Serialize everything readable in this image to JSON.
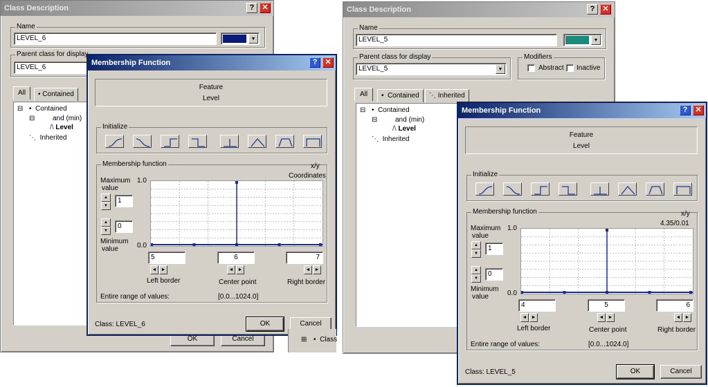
{
  "left": {
    "class_desc": {
      "title": "Class Description",
      "name_label": "Name",
      "name_value": "LEVEL_6",
      "color": "#0a1a7a",
      "parent_label": "Parent class for display",
      "parent_value": "LEVEL_6",
      "tabs": [
        "All",
        "Contained"
      ],
      "tree": {
        "contained": "Contained",
        "and": "and (min)",
        "level": "Level",
        "inherited": "Inherited"
      },
      "ok_label": "OK",
      "cancel_label": "Cancel"
    },
    "mf": {
      "title": "Membership Function",
      "feature_label": "Feature",
      "feature_value": "Level",
      "initialize_label": "Initialize",
      "mf_label": "Membership function",
      "xy_label": "x/y",
      "coord_text": "Coordinates",
      "max_label_1": "Maximum",
      "max_label_2": "value",
      "max_value": "1",
      "min_label_1": "Minimum",
      "min_label_2": "value",
      "min_value": "0",
      "y_top": "1.0",
      "y_bottom": "0.0",
      "left_border_value": "5",
      "center_value": "6",
      "right_border_value": "7",
      "left_border_label": "Left border",
      "center_label": "Center point",
      "right_border_label": "Right border",
      "range_label": "Entire range of values:",
      "range_value": "[0.0...1024.0]",
      "class_text": "Class: LEVEL_6",
      "ok_label": "OK",
      "cancel_label": "Cancel",
      "membership": {
        "x": [
          5,
          6,
          7
        ],
        "y": [
          0,
          1,
          0
        ]
      }
    },
    "behind_tree_text": "Class"
  },
  "right": {
    "class_desc": {
      "title": "Class Description",
      "name_label": "Name",
      "name_value": "LEVEL_5",
      "color": "#1a8a7a",
      "parent_label": "Parent class for display",
      "parent_value": "LEVEL_5",
      "modifiers_label": "Modifiers",
      "abstract_label": "Abstract",
      "inactive_label": "Inactive",
      "tabs": [
        "All",
        "Contained",
        "Inherited"
      ],
      "tree": {
        "contained": "Contained",
        "and": "and (min)",
        "level": "Level",
        "inherited": "Inherited"
      }
    },
    "mf": {
      "title": "Membership Function",
      "feature_label": "Feature",
      "feature_value": "Level",
      "initialize_label": "Initialize",
      "mf_label": "Membership function",
      "xy_label": "x/y",
      "coord_text": "4.35/0.01",
      "max_label_1": "Maximum",
      "max_label_2": "value",
      "max_value": "1",
      "min_label_1": "Minimum",
      "min_label_2": "value",
      "min_value": "0",
      "y_top": "1.0",
      "y_bottom": "0.0",
      "left_border_value": "4",
      "center_value": "5",
      "right_border_value": "6",
      "left_border_label": "Left border",
      "center_label": "Center point",
      "right_border_label": "Right border",
      "range_label": "Entire range of values:",
      "range_value": "[0.0...1024.0]",
      "class_text": "Class: LEVEL_5",
      "ok_label": "OK",
      "cancel_label": "Cancel",
      "membership": {
        "x": [
          4,
          5,
          6
        ],
        "y": [
          0,
          1,
          0
        ]
      }
    }
  },
  "icons": {
    "init_buttons": [
      "s-curve-icon",
      "z-curve-icon",
      "step-up-icon",
      "step-down-icon",
      "singleton-icon",
      "triangle-icon",
      "trapezoid-icon",
      "rectangle-icon"
    ]
  }
}
